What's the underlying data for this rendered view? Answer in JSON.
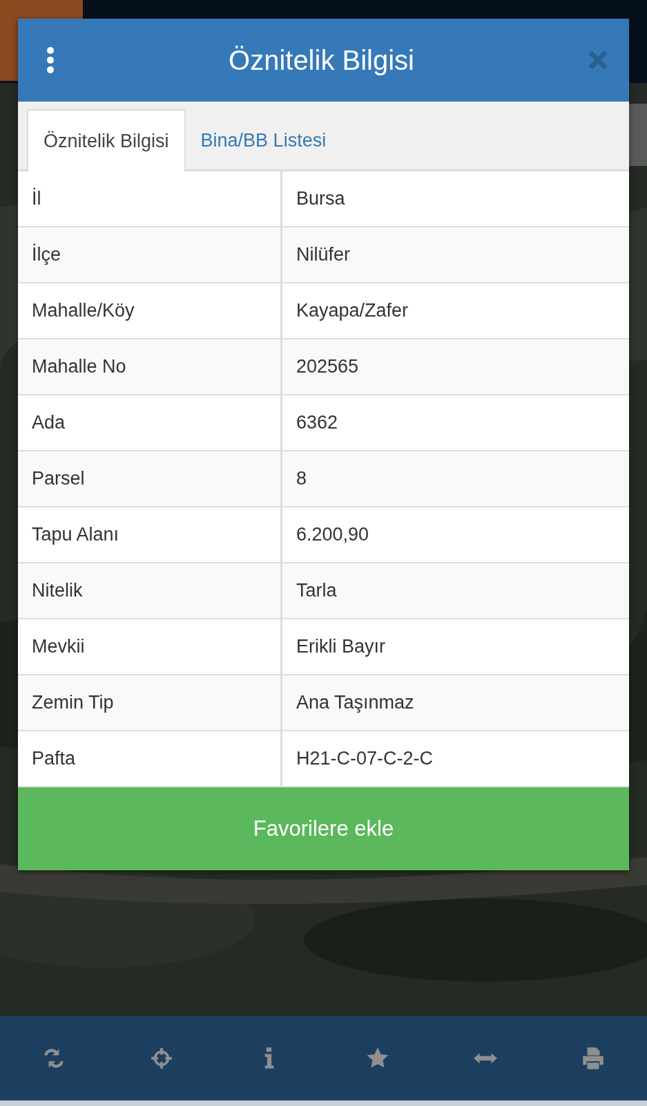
{
  "dialog": {
    "title": "Öznitelik Bilgisi"
  },
  "tabs": [
    {
      "label": "Öznitelik Bilgisi",
      "selected": true
    },
    {
      "label": "Bina/BB Listesi",
      "selected": false
    }
  ],
  "rows": [
    {
      "label": "İl",
      "value": "Bursa"
    },
    {
      "label": "İlçe",
      "value": "Nilüfer"
    },
    {
      "label": "Mahalle/Köy",
      "value": "Kayapa/Zafer"
    },
    {
      "label": "Mahalle No",
      "value": "202565"
    },
    {
      "label": "Ada",
      "value": "6362"
    },
    {
      "label": "Parsel",
      "value": "8"
    },
    {
      "label": "Tapu Alanı",
      "value": "6.200,90"
    },
    {
      "label": "Nitelik",
      "value": "Tarla"
    },
    {
      "label": "Mevkii",
      "value": "Erikli Bayır"
    },
    {
      "label": "Zemin Tip",
      "value": "Ana Taşınmaz"
    },
    {
      "label": "Pafta",
      "value": "H21-C-07-C-2-C"
    }
  ],
  "action_button": "Favorilere ekle",
  "toolbar": [
    {
      "kind": "refresh"
    },
    {
      "kind": "locate"
    },
    {
      "kind": "info"
    },
    {
      "kind": "star"
    },
    {
      "kind": "resize"
    },
    {
      "kind": "print"
    }
  ]
}
